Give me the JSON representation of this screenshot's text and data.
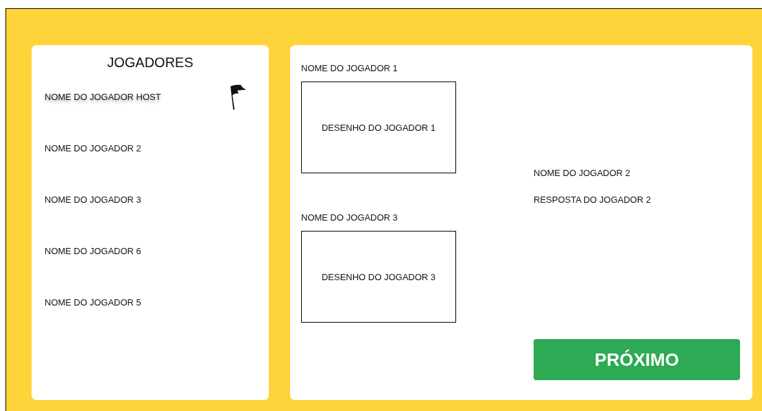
{
  "players_panel": {
    "title": "JOGADORES",
    "players": [
      {
        "name": "NOME DO JOGADOR HOST",
        "host": true
      },
      {
        "name": "NOME DO JOGADOR 2",
        "host": false
      },
      {
        "name": "NOME DO JOGADOR 3",
        "host": false
      },
      {
        "name": "NOME DO JOGADOR 6",
        "host": false
      },
      {
        "name": "NOME DO JOGADOR 5",
        "host": false
      }
    ]
  },
  "drawings": [
    {
      "player": "NOME DO JOGADOR 1",
      "drawing": "DESENHO DO JOGADOR 1"
    },
    {
      "player": "NOME DO JOGADOR 3",
      "drawing": "DESENHO DO JOGADOR 3"
    }
  ],
  "answers": [
    {
      "player": "NOME DO JOGADOR 2",
      "answer": "RESPOSTA DO JOGADOR 2"
    }
  ],
  "next_button": "PRÓXIMO"
}
